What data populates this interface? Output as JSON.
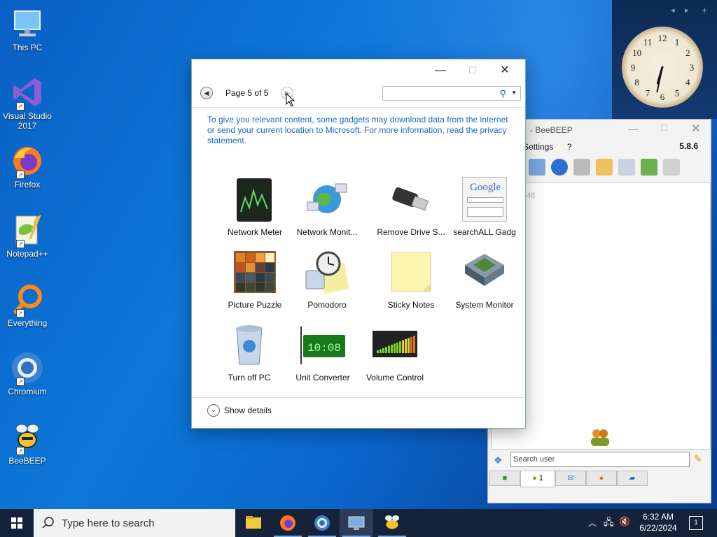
{
  "desktop": {
    "icons": [
      {
        "label": "This PC",
        "icon": "this-pc-icon"
      },
      {
        "label": "Visual Studio 2017",
        "icon": "visual-studio-icon"
      },
      {
        "label": "Firefox",
        "icon": "firefox-icon"
      },
      {
        "label": "Notepad++",
        "icon": "notepad-plus-plus-icon"
      },
      {
        "label": "Everything",
        "icon": "everything-icon"
      },
      {
        "label": "Chromium",
        "icon": "chromium-icon"
      },
      {
        "label": "BeeBEEP",
        "icon": "beebeep-icon"
      }
    ]
  },
  "sidebar": {
    "clock_numbers": [
      "12",
      "1",
      "2",
      "3",
      "4",
      "5",
      "6",
      "7",
      "8",
      "9",
      "10",
      "11"
    ]
  },
  "gallery": {
    "page_label": "Page 5 of 5",
    "search_value": "",
    "privacy_text": "To give you relevant content, some gadgets may download data from the internet or send your current location to Microsoft. For more information, read the privacy statement.",
    "gadgets": [
      {
        "label": "Network Meter",
        "icon": "network-meter-icon"
      },
      {
        "label": "Network Monit...",
        "icon": "network-monitor-icon"
      },
      {
        "label": "Remove Drive S...",
        "icon": "usb-drive-icon"
      },
      {
        "label": "searchALL Gadg",
        "icon": "google-search-icon"
      },
      {
        "label": "Picture Puzzle",
        "icon": "picture-puzzle-icon"
      },
      {
        "label": "Pomodoro",
        "icon": "pomodoro-icon"
      },
      {
        "label": "Sticky Notes",
        "icon": "sticky-notes-icon"
      },
      {
        "label": "System Monitor",
        "icon": "cpu-chip-icon"
      },
      {
        "label": "Turn off PC",
        "icon": "recycle-bin-icon"
      },
      {
        "label": "Unit Converter",
        "icon": "digital-display-icon"
      },
      {
        "label": "Volume Control",
        "icon": "volume-meter-icon"
      }
    ],
    "show_details_label": "Show details",
    "google_text": "Google"
  },
  "beebeep": {
    "title": "- BeeBEEP",
    "menu_settings": "Settings",
    "menu_help": "?",
    "version": "5.8.6",
    "search_placeholder": "Search user",
    "tab_users_count": "1",
    "content_digits": "46"
  },
  "taskbar": {
    "search_placeholder": "Type here to search",
    "time": "6:32 AM",
    "date": "6/22/2024",
    "notification_count": "1",
    "pinned": [
      "file-explorer-icon",
      "firefox-icon",
      "chromium-icon",
      "gadgets-icon",
      "beebeep-icon"
    ]
  },
  "colors": {
    "accent_link": "#1a6cc4",
    "taskbar": "#16223a",
    "desktop": "#0b6fd2"
  }
}
